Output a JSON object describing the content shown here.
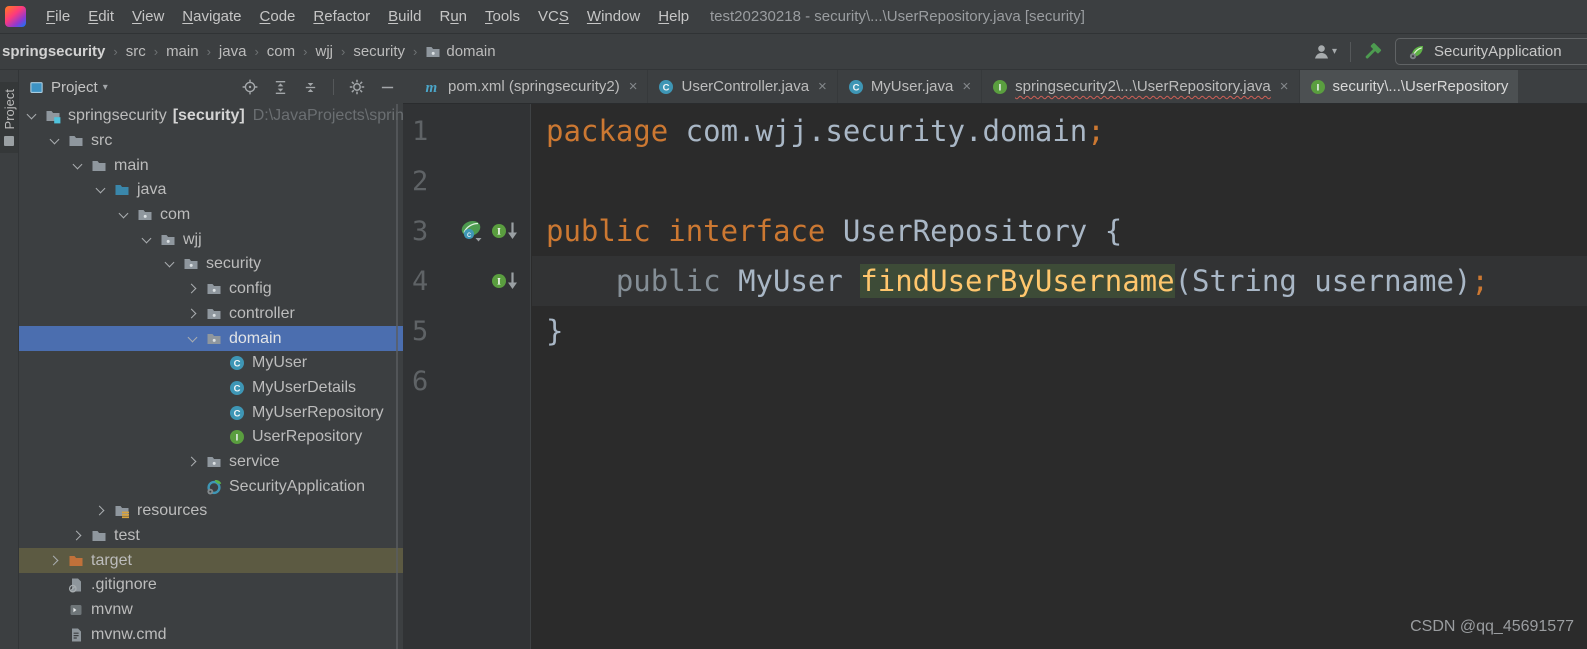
{
  "window": {
    "title": "test20230218 - security\\...\\UserRepository.java [security]"
  },
  "menu": [
    {
      "label": "File",
      "u": 0
    },
    {
      "label": "Edit",
      "u": 0
    },
    {
      "label": "View",
      "u": 0
    },
    {
      "label": "Navigate",
      "u": 0
    },
    {
      "label": "Code",
      "u": 0
    },
    {
      "label": "Refactor",
      "u": 0
    },
    {
      "label": "Build",
      "u": 0
    },
    {
      "label": "Run",
      "u": 1
    },
    {
      "label": "Tools",
      "u": 0
    },
    {
      "label": "VCS",
      "u": 2
    },
    {
      "label": "Window",
      "u": 0
    },
    {
      "label": "Help",
      "u": 0
    }
  ],
  "breadcrumbs": [
    {
      "label": "springsecurity",
      "bold": true
    },
    {
      "label": "src"
    },
    {
      "label": "main"
    },
    {
      "label": "java"
    },
    {
      "label": "com"
    },
    {
      "label": "wjj"
    },
    {
      "label": "security"
    },
    {
      "label": "domain",
      "icon": "package"
    }
  ],
  "run_widget": {
    "config_name": "SecurityApplication"
  },
  "stripe": {
    "label": "Project"
  },
  "project_panel": {
    "title": "Project"
  },
  "tabs": [
    {
      "icon": "maven",
      "label": "pom.xml (springsecurity2)",
      "close": true
    },
    {
      "icon": "class",
      "label": "UserController.java",
      "close": true
    },
    {
      "icon": "class",
      "label": "MyUser.java",
      "close": true
    },
    {
      "icon": "interface",
      "label": "springsecurity2\\...\\UserRepository.java",
      "close": true,
      "error": true
    },
    {
      "icon": "interface",
      "label": "security\\...\\UserRepository",
      "close": false,
      "active": true
    }
  ],
  "tree": [
    {
      "label": "springsecurity",
      "label2": "[security]",
      "suffix": "D:\\JavaProjects\\sprin",
      "level": 0,
      "chevron": "expanded",
      "icon": "project-root"
    },
    {
      "label": "src",
      "level": 1,
      "chevron": "expanded",
      "icon": "folder"
    },
    {
      "label": "main",
      "level": 2,
      "chevron": "expanded",
      "icon": "folder"
    },
    {
      "label": "java",
      "level": 3,
      "chevron": "expanded",
      "icon": "folder-sources"
    },
    {
      "label": "com",
      "level": 4,
      "chevron": "expanded",
      "icon": "package"
    },
    {
      "label": "wjj",
      "level": 5,
      "chevron": "expanded",
      "icon": "package"
    },
    {
      "label": "security",
      "level": 6,
      "chevron": "expanded",
      "icon": "package"
    },
    {
      "label": "config",
      "level": 7,
      "chevron": "collapsed",
      "icon": "package"
    },
    {
      "label": "controller",
      "level": 7,
      "chevron": "collapsed",
      "icon": "package"
    },
    {
      "label": "domain",
      "level": 7,
      "chevron": "expanded",
      "icon": "package",
      "state": "selected"
    },
    {
      "label": "MyUser",
      "level": 8,
      "icon": "class"
    },
    {
      "label": "MyUserDetails",
      "level": 8,
      "icon": "class"
    },
    {
      "label": "MyUserRepository",
      "level": 8,
      "icon": "class"
    },
    {
      "label": "UserRepository",
      "level": 8,
      "icon": "interface"
    },
    {
      "label": "service",
      "level": 7,
      "chevron": "collapsed",
      "icon": "package"
    },
    {
      "label": "SecurityApplication",
      "level": 7,
      "icon": "springboot"
    },
    {
      "label": "resources",
      "level": 3,
      "chevron": "collapsed",
      "icon": "folder-resources"
    },
    {
      "label": "test",
      "level": 2,
      "chevron": "collapsed",
      "icon": "folder"
    },
    {
      "label": "target",
      "level": 1,
      "chevron": "collapsed",
      "icon": "folder-excluded",
      "state": "highlighted"
    },
    {
      "label": ".gitignore",
      "level": 1,
      "icon": "file-ignored"
    },
    {
      "label": "mvnw",
      "level": 1,
      "icon": "file-shell"
    },
    {
      "label": "mvnw.cmd",
      "level": 1,
      "icon": "file-text"
    }
  ],
  "editor": {
    "lines": [
      {
        "num": "1",
        "gutter": [],
        "tokens": [
          [
            "kw",
            "package"
          ],
          [
            "pl",
            " com.wjj.security.domain"
          ],
          [
            "kw",
            ";"
          ]
        ]
      },
      {
        "num": "2",
        "gutter": [],
        "tokens": []
      },
      {
        "num": "3",
        "gutter": [
          "spring-bean",
          "implementers"
        ],
        "tokens": [
          [
            "kw",
            "public"
          ],
          [
            "pl",
            " "
          ],
          [
            "kw",
            "interface"
          ],
          [
            "pl",
            " UserRepository {"
          ]
        ]
      },
      {
        "num": "4",
        "gutter": [
          "implementers"
        ],
        "caret": true,
        "tokens": [
          [
            "pl",
            "    "
          ],
          [
            "mod",
            "public"
          ],
          [
            "pl",
            " MyUser "
          ],
          [
            "mth",
            "findUserByUsername"
          ],
          [
            "pl",
            "(String username)"
          ],
          [
            "kw",
            ";"
          ]
        ]
      },
      {
        "num": "5",
        "gutter": [],
        "tokens": [
          [
            "pl",
            "}"
          ]
        ]
      },
      {
        "num": "6",
        "gutter": [],
        "tokens": []
      }
    ]
  },
  "watermark": "CSDN @qq_45691577",
  "colors": {
    "chrome_bg": "#3c3f41",
    "editor_bg": "#2b2b2b",
    "selection_blue": "#4b6eaf",
    "target_highlight": "#5c5a42",
    "keyword_orange": "#cc7832",
    "method_yellow": "#ffc66d",
    "method_highlight_bg": "#3d4b37",
    "interface_green": "#5a9e3f",
    "class_teal": "#3e96b5",
    "error_red": "#cf5f56"
  }
}
